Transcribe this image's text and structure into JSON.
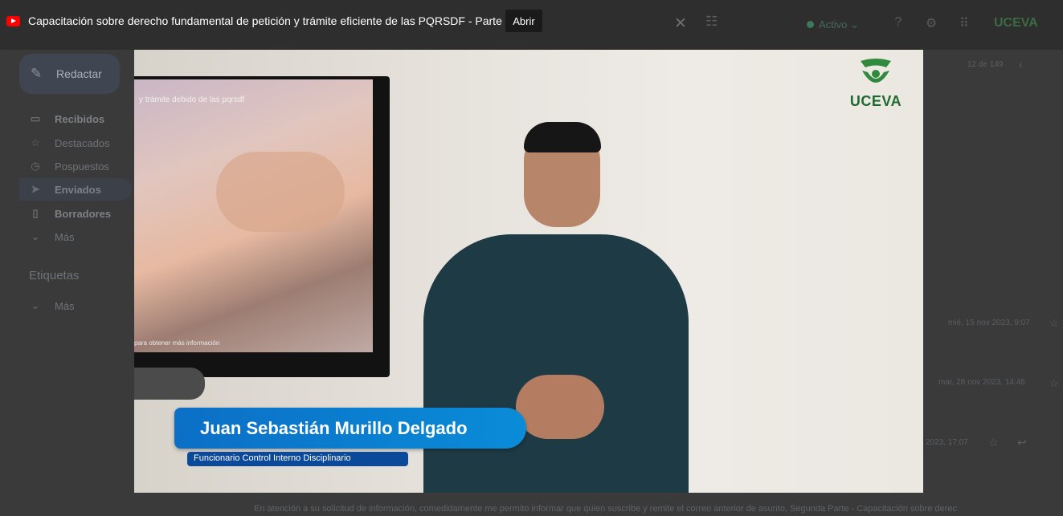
{
  "overlay": {
    "video_title": "Capacitación sobre derecho fundamental de petición y trámite eficiente de las PQRSDF - Parte II",
    "open_label": "Abrir"
  },
  "header": {
    "status": "Activo",
    "brand": "UCEVA"
  },
  "sidebar": {
    "compose_label": "Redactar",
    "items": [
      {
        "label": "Recibidos"
      },
      {
        "label": "Destacados"
      },
      {
        "label": "Pospuestos"
      },
      {
        "label": "Enviados"
      },
      {
        "label": "Borradores"
      },
      {
        "label": "Más"
      }
    ],
    "labels_title": "Etiquetas",
    "labels_more": "Más"
  },
  "mail": {
    "counter": "12 de 149",
    "date1": "mié, 15 nov 2023, 9:07",
    "date2": "mar, 28 nov 2023, 14:46",
    "date3": "2023, 17:07",
    "bottom_text": "En atención a su solicitud de información, comedidamente me permito informar que quien suscribe y remite el correo anterior de asunto, Segunda Parte - Capacitación sobre derec"
  },
  "video": {
    "tv_caption": "y trámite debido de las pqrsdf",
    "tv_bottom": "para obtener más información",
    "logo_text": "UCEVA",
    "name": "Juan Sebastián Murillo Delgado",
    "role": "Funcionario Control Interno Disciplinario"
  },
  "colors": {
    "name_card": "#0a7fd0",
    "role_card": "#0b4a9b",
    "logo_green": "#1f6a2e",
    "yt_red": "#ff0000"
  }
}
